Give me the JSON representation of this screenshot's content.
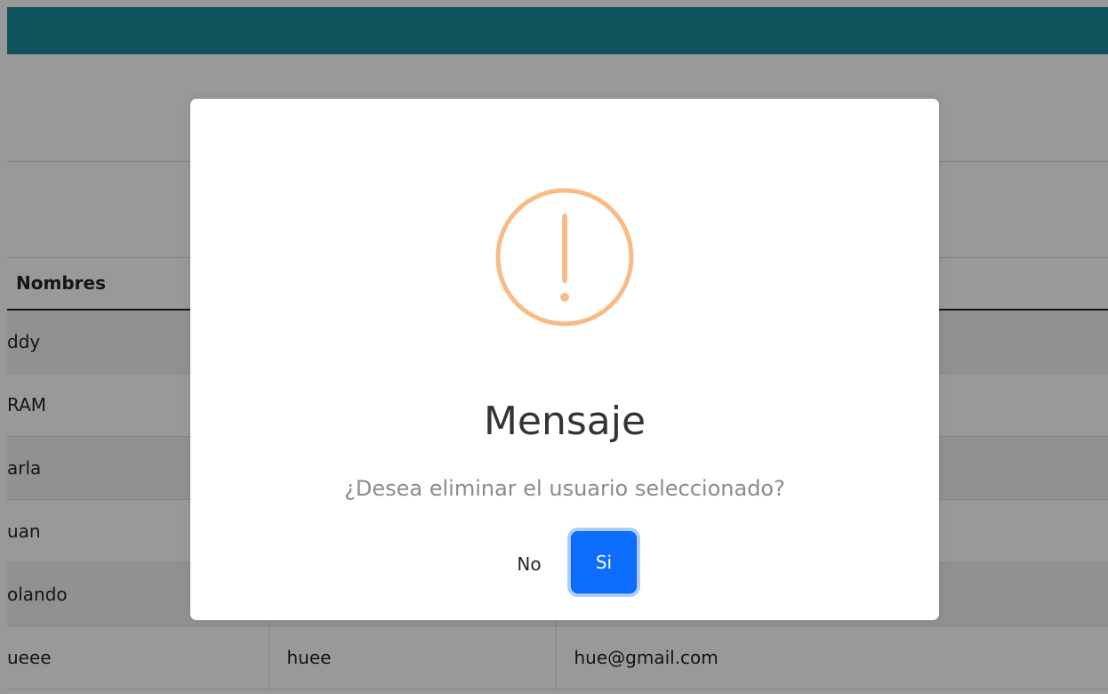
{
  "table": {
    "headers": [
      "Nombres",
      "",
      ""
    ],
    "rows": [
      [
        "ddy",
        "",
        ""
      ],
      [
        "RAM",
        "",
        ""
      ],
      [
        "arla",
        "",
        ""
      ],
      [
        "uan",
        "",
        ""
      ],
      [
        "olando",
        "",
        ""
      ],
      [
        "ueee",
        "huee",
        "hue@gmail.com"
      ]
    ]
  },
  "modal": {
    "icon": "warning-icon",
    "icon_color": "#f8bb86",
    "title": "Mensaje",
    "text": "¿Desea eliminar el usuario seleccionado?",
    "no_label": "No",
    "yes_label": "Si"
  },
  "colors": {
    "header_bar": "#1b8b9a",
    "primary": "#0d6efd"
  }
}
